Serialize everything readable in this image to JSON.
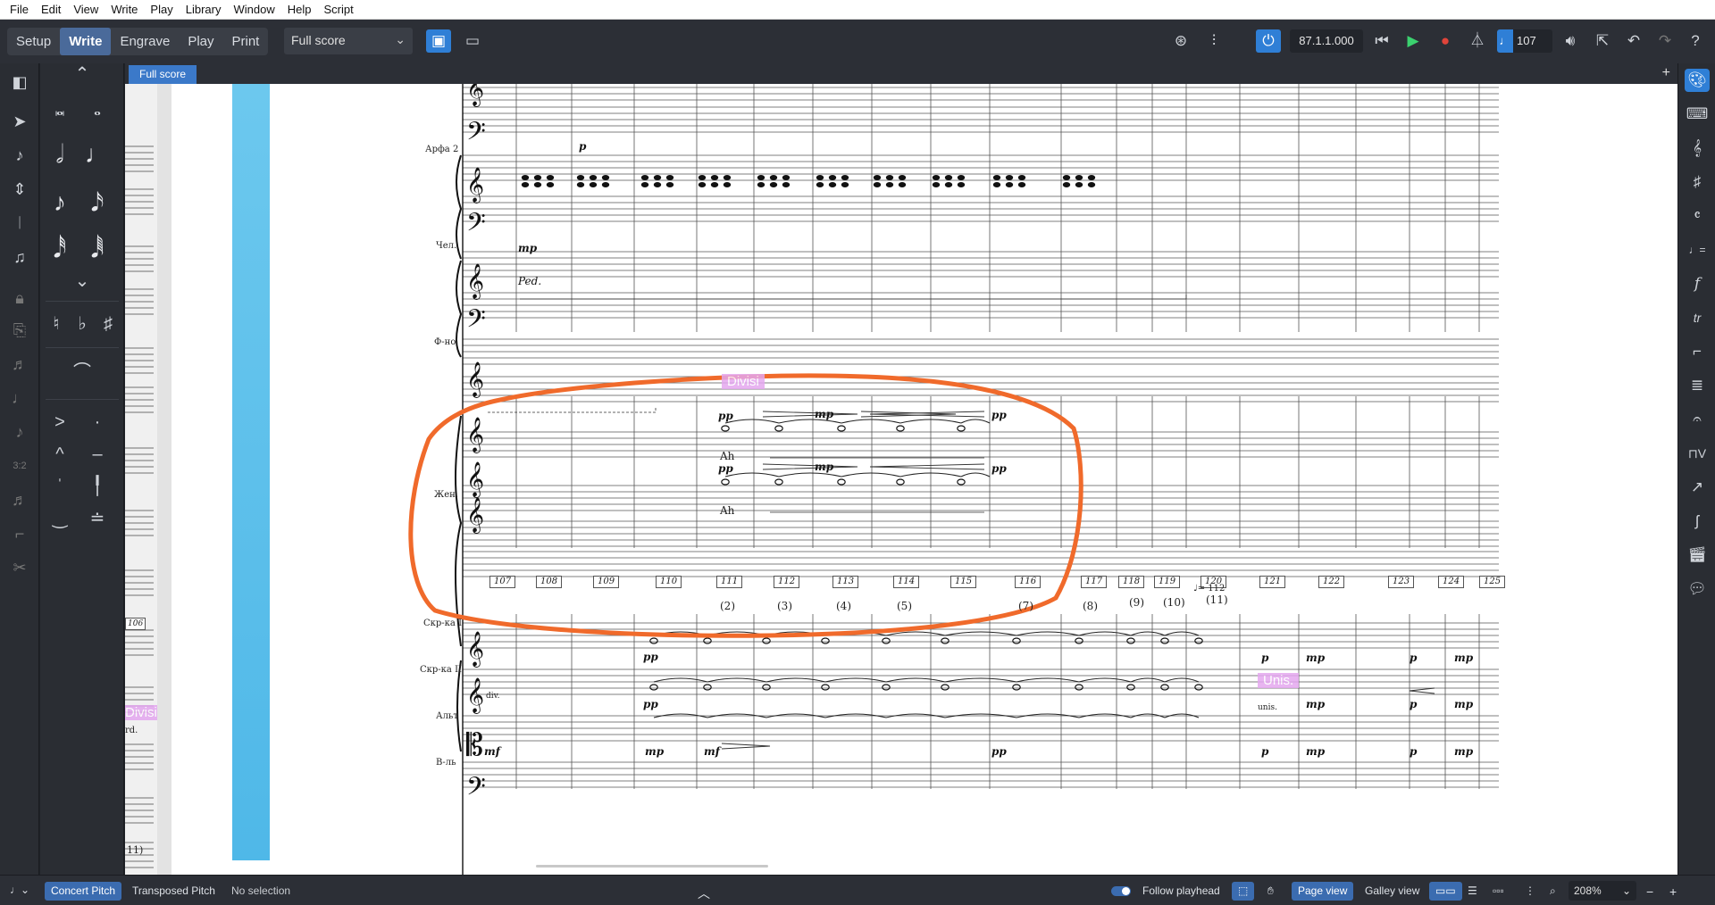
{
  "menu": [
    "File",
    "Edit",
    "View",
    "Write",
    "Play",
    "Library",
    "Window",
    "Help",
    "Script"
  ],
  "modes": [
    {
      "label": "Setup",
      "active": false
    },
    {
      "label": "Write",
      "active": true
    },
    {
      "label": "Engrave",
      "active": false
    },
    {
      "label": "Play",
      "active": false
    },
    {
      "label": "Print",
      "active": false
    }
  ],
  "layout_select": {
    "value": "Full score"
  },
  "transport": {
    "position": "87.1.1.000",
    "tempo": "107"
  },
  "score_tab": "Full score",
  "instruments": [
    "Арфа 2",
    "Чел.",
    "Ф-но",
    "Жен.",
    "Скр-ка I",
    "Скр-ка II",
    "Альт",
    "В-ль"
  ],
  "bar_numbers": [
    "107",
    "108",
    "109",
    "110",
    "111",
    "112",
    "113",
    "114",
    "115",
    "116",
    "117",
    "118",
    "119",
    "120",
    "121",
    "122",
    "123",
    "124",
    "125"
  ],
  "rehearsal_markers": [
    "(2)",
    "(3)",
    "(4)",
    "(5)",
    "(7)",
    "(8)",
    "(9)",
    "(10)",
    "(11)"
  ],
  "tempo_mark": "♩= 112",
  "prev_page": {
    "bar_label": "106",
    "marker": "11)",
    "text": "rd.",
    "divisi": "Divisi"
  },
  "dynamics": {
    "harp_p": "p",
    "celesta_mp": "mp",
    "pedal": "Ped.",
    "voice_pp_1": "pp",
    "voice_mp_1": "mp",
    "voice_pp_2": "pp",
    "voice_pp_3": "pp",
    "voice_mp_2": "mp",
    "voice_pp_4": "pp",
    "vln1_pp": "pp",
    "vln2_pp": "pp",
    "vla_mf_1": "mf",
    "vla_mp": "mp",
    "vla_mf_2": "mf",
    "vla_pp": "pp",
    "vln1_p": "p",
    "vln1_mp_1": "mp",
    "vln1_p_2": "p",
    "vln1_mp_2": "mp",
    "vln2_mp": "mp",
    "vln2_p": "p",
    "vln2_mp_2": "mp",
    "vla_p": "p",
    "vla_mp_2": "mp",
    "vla_p_2": "p",
    "vla_mp_3": "mp"
  },
  "lyrics": [
    "Ah",
    "Ah"
  ],
  "techniques": {
    "div": "div.",
    "unis": "unis."
  },
  "tags": {
    "divisi": "Divisi",
    "unis": "Unis."
  },
  "status": {
    "concert_pitch": "Concert Pitch",
    "transposed_pitch": "Transposed Pitch",
    "selection": "No selection",
    "follow_playhead": "Follow playhead",
    "page_view": "Page view",
    "galley_view": "Galley view",
    "zoom": "208%"
  },
  "colors": {
    "accent": "#2f7fd6",
    "annotation": "#f06a2b",
    "playhead": "#5bbfeb",
    "divisi": "#e4a7ef"
  }
}
